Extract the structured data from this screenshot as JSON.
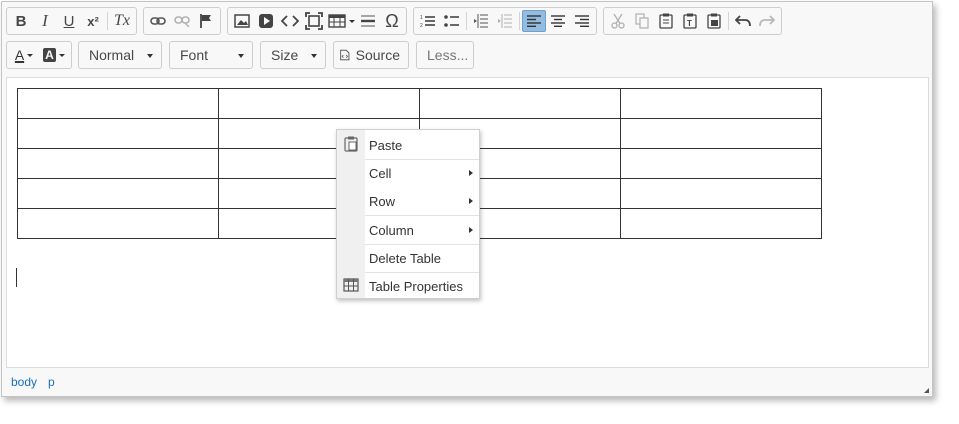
{
  "toolbar": {
    "format_label": "Normal",
    "font_label": "Font",
    "size_label": "Size",
    "source_label": "Source",
    "less_label": "Less..."
  },
  "icons": {
    "bold": "B",
    "italic": "I",
    "underline": "U",
    "superscript": "x²",
    "remove_format": "Tx",
    "omega": "Ω",
    "text_color": "A",
    "bg_color": "A"
  },
  "context_menu": {
    "paste": "Paste",
    "cell": "Cell",
    "row": "Row",
    "column": "Column",
    "delete_table": "Delete Table",
    "table_properties": "Table Properties"
  },
  "status_path": [
    "body",
    "p"
  ],
  "colors": {
    "active_button": "#92bce0",
    "path_link": "#1a6fba",
    "text_color_bar": "#333333"
  }
}
